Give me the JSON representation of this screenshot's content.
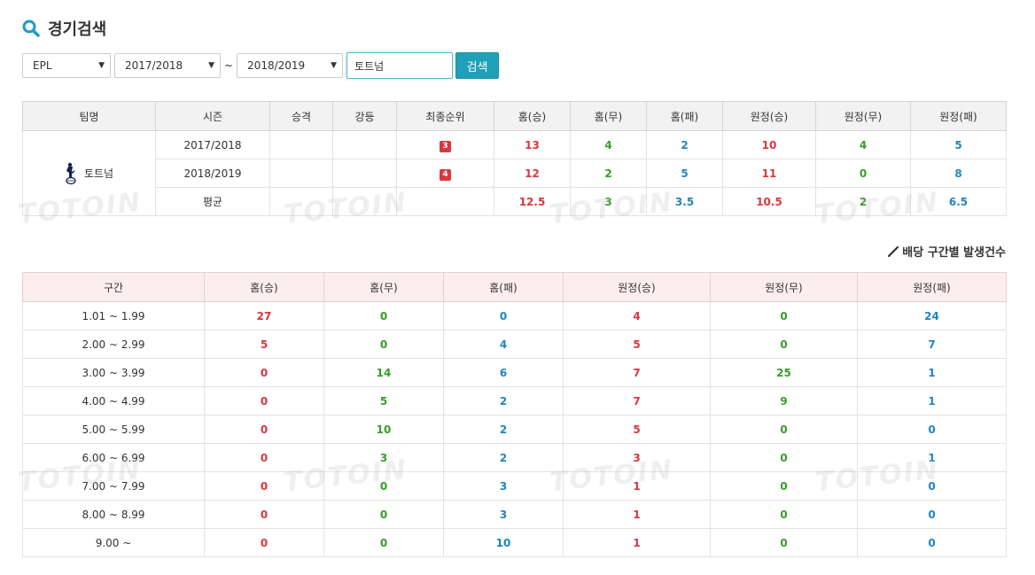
{
  "page_title": "경기검색",
  "filters": {
    "league": "EPL",
    "season_from": "2017/2018",
    "separator": "~",
    "season_to": "2018/2019",
    "team_value": "토트넘",
    "search_label": "검색"
  },
  "summary": {
    "headers": [
      "팀명",
      "시즌",
      "승격",
      "강등",
      "최종순위",
      "홈(승)",
      "홈(무)",
      "홈(패)",
      "원정(승)",
      "원정(무)",
      "원정(패)"
    ],
    "team": "토트넘",
    "rows": [
      {
        "season": "2017/2018",
        "rank": "3",
        "hw": "13",
        "hd": "4",
        "hl": "2",
        "aw": "10",
        "ad": "4",
        "al": "5"
      },
      {
        "season": "2018/2019",
        "rank": "4",
        "hw": "12",
        "hd": "2",
        "hl": "5",
        "aw": "11",
        "ad": "0",
        "al": "8"
      },
      {
        "season": "평균",
        "rank": "",
        "hw": "12.5",
        "hd": "3",
        "hl": "3.5",
        "aw": "10.5",
        "ad": "2",
        "al": "6.5"
      }
    ]
  },
  "odds": {
    "title": "배당 구간별 발생건수",
    "headers": [
      "구간",
      "홈(승)",
      "홈(무)",
      "홈(패)",
      "원정(승)",
      "원정(무)",
      "원정(패)"
    ],
    "rows": [
      [
        "1.01 ~ 1.99",
        "27",
        "0",
        "0",
        "4",
        "0",
        "24"
      ],
      [
        "2.00 ~ 2.99",
        "5",
        "0",
        "4",
        "5",
        "0",
        "7"
      ],
      [
        "3.00 ~ 3.99",
        "0",
        "14",
        "6",
        "7",
        "25",
        "1"
      ],
      [
        "4.00 ~ 4.99",
        "0",
        "5",
        "2",
        "7",
        "9",
        "1"
      ],
      [
        "5.00 ~ 5.99",
        "0",
        "10",
        "2",
        "5",
        "0",
        "0"
      ],
      [
        "6.00 ~ 6.99",
        "0",
        "3",
        "2",
        "3",
        "0",
        "1"
      ],
      [
        "7.00 ~ 7.99",
        "0",
        "0",
        "3",
        "1",
        "0",
        "0"
      ],
      [
        "8.00 ~ 8.99",
        "0",
        "0",
        "3",
        "1",
        "0",
        "0"
      ],
      [
        "9.00 ~",
        "0",
        "0",
        "10",
        "1",
        "0",
        "0"
      ]
    ]
  },
  "watermark": "TOTOIN",
  "colors": {
    "win": "#d9363e",
    "draw": "#3a9a2c",
    "loss": "#2085c2",
    "accent": "#20a0b6"
  }
}
